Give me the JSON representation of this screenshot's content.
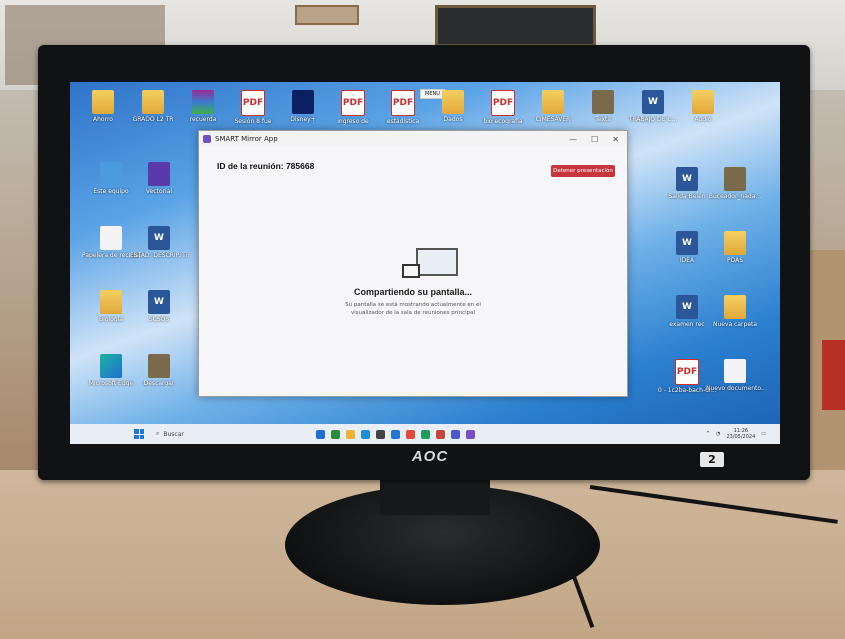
{
  "window": {
    "title": "SMART Mirror App",
    "meeting_label": "ID de la reunión: 785668",
    "stop_button": "Detener presentación",
    "sharing_title": "Compartiendo su pantalla...",
    "sharing_desc_line1": "Su pantalla se está mostrando actualmente en el",
    "sharing_desc_line2": "visualizador de la sala de reuniones principal",
    "controls": [
      "—",
      "☐",
      "✕"
    ]
  },
  "menu_tip": "MENU",
  "desktop_icons_top": [
    {
      "label": "Ahorro",
      "kind": "folder"
    },
    {
      "label": "GRADO L2 TR",
      "kind": "folder"
    },
    {
      "label": "recuerda",
      "kind": "rar"
    },
    {
      "label": "Sesión 8 fue",
      "kind": "pdf"
    },
    {
      "label": "Disney+",
      "kind": "disney"
    },
    {
      "label": "ingreso de",
      "kind": "pdf"
    },
    {
      "label": "estadística",
      "kind": "pdf"
    },
    {
      "label": "Dados",
      "kind": "folder"
    },
    {
      "label": "bio ecografía",
      "kind": "pdf"
    },
    {
      "label": "CIMESAVER",
      "kind": "folder"
    },
    {
      "label": "Textil",
      "kind": "img"
    },
    {
      "label": "TRABAJO DE C...",
      "kind": "word"
    },
    {
      "label": "Audio",
      "kind": "folder"
    }
  ],
  "desktop_icons_left": [
    {
      "label": "Este equipo",
      "kind": "pc"
    },
    {
      "label": "Papelera de reciclaje",
      "kind": "file"
    },
    {
      "label": "Biología",
      "kind": "folder"
    },
    {
      "label": "Microsoft Edge",
      "kind": "edge"
    }
  ],
  "desktop_icons_left2": [
    {
      "label": "Vectorial",
      "kind": "app"
    },
    {
      "label": "ESTAD. DESCRIP. TRABAJO DE BG...",
      "kind": "word"
    },
    {
      "label": "SCSOS",
      "kind": "word"
    },
    {
      "label": "Descargar",
      "kind": "img"
    }
  ],
  "desktop_icons_right": [
    {
      "label": "Salida Belén",
      "kind": "word"
    },
    {
      "label": "Buceador_nada...",
      "kind": "img"
    },
    {
      "label": "IDEA",
      "kind": "word"
    },
    {
      "label": "PDAS",
      "kind": "folder"
    },
    {
      "label": "examen rec",
      "kind": "word"
    },
    {
      "label": "Nueva carpeta",
      "kind": "folder"
    },
    {
      "label": "0 - 1c2ba-bach-un...",
      "kind": "pdf"
    },
    {
      "label": "Nuevo documento...",
      "kind": "file"
    }
  ],
  "taskbar": {
    "search_placeholder": "Buscar",
    "time": "11:26",
    "date": "23/05/2024",
    "apps": [
      "#1f6fd1",
      "#2b8a3e",
      "#f2b233",
      "#1b8fd6",
      "#444",
      "#1f78d1",
      "#e24b3b",
      "#1d9e5a",
      "#c6483a",
      "#4a58c9",
      "#7b4ec9"
    ]
  },
  "monitor": {
    "brand": "AOC",
    "badge": "2"
  }
}
